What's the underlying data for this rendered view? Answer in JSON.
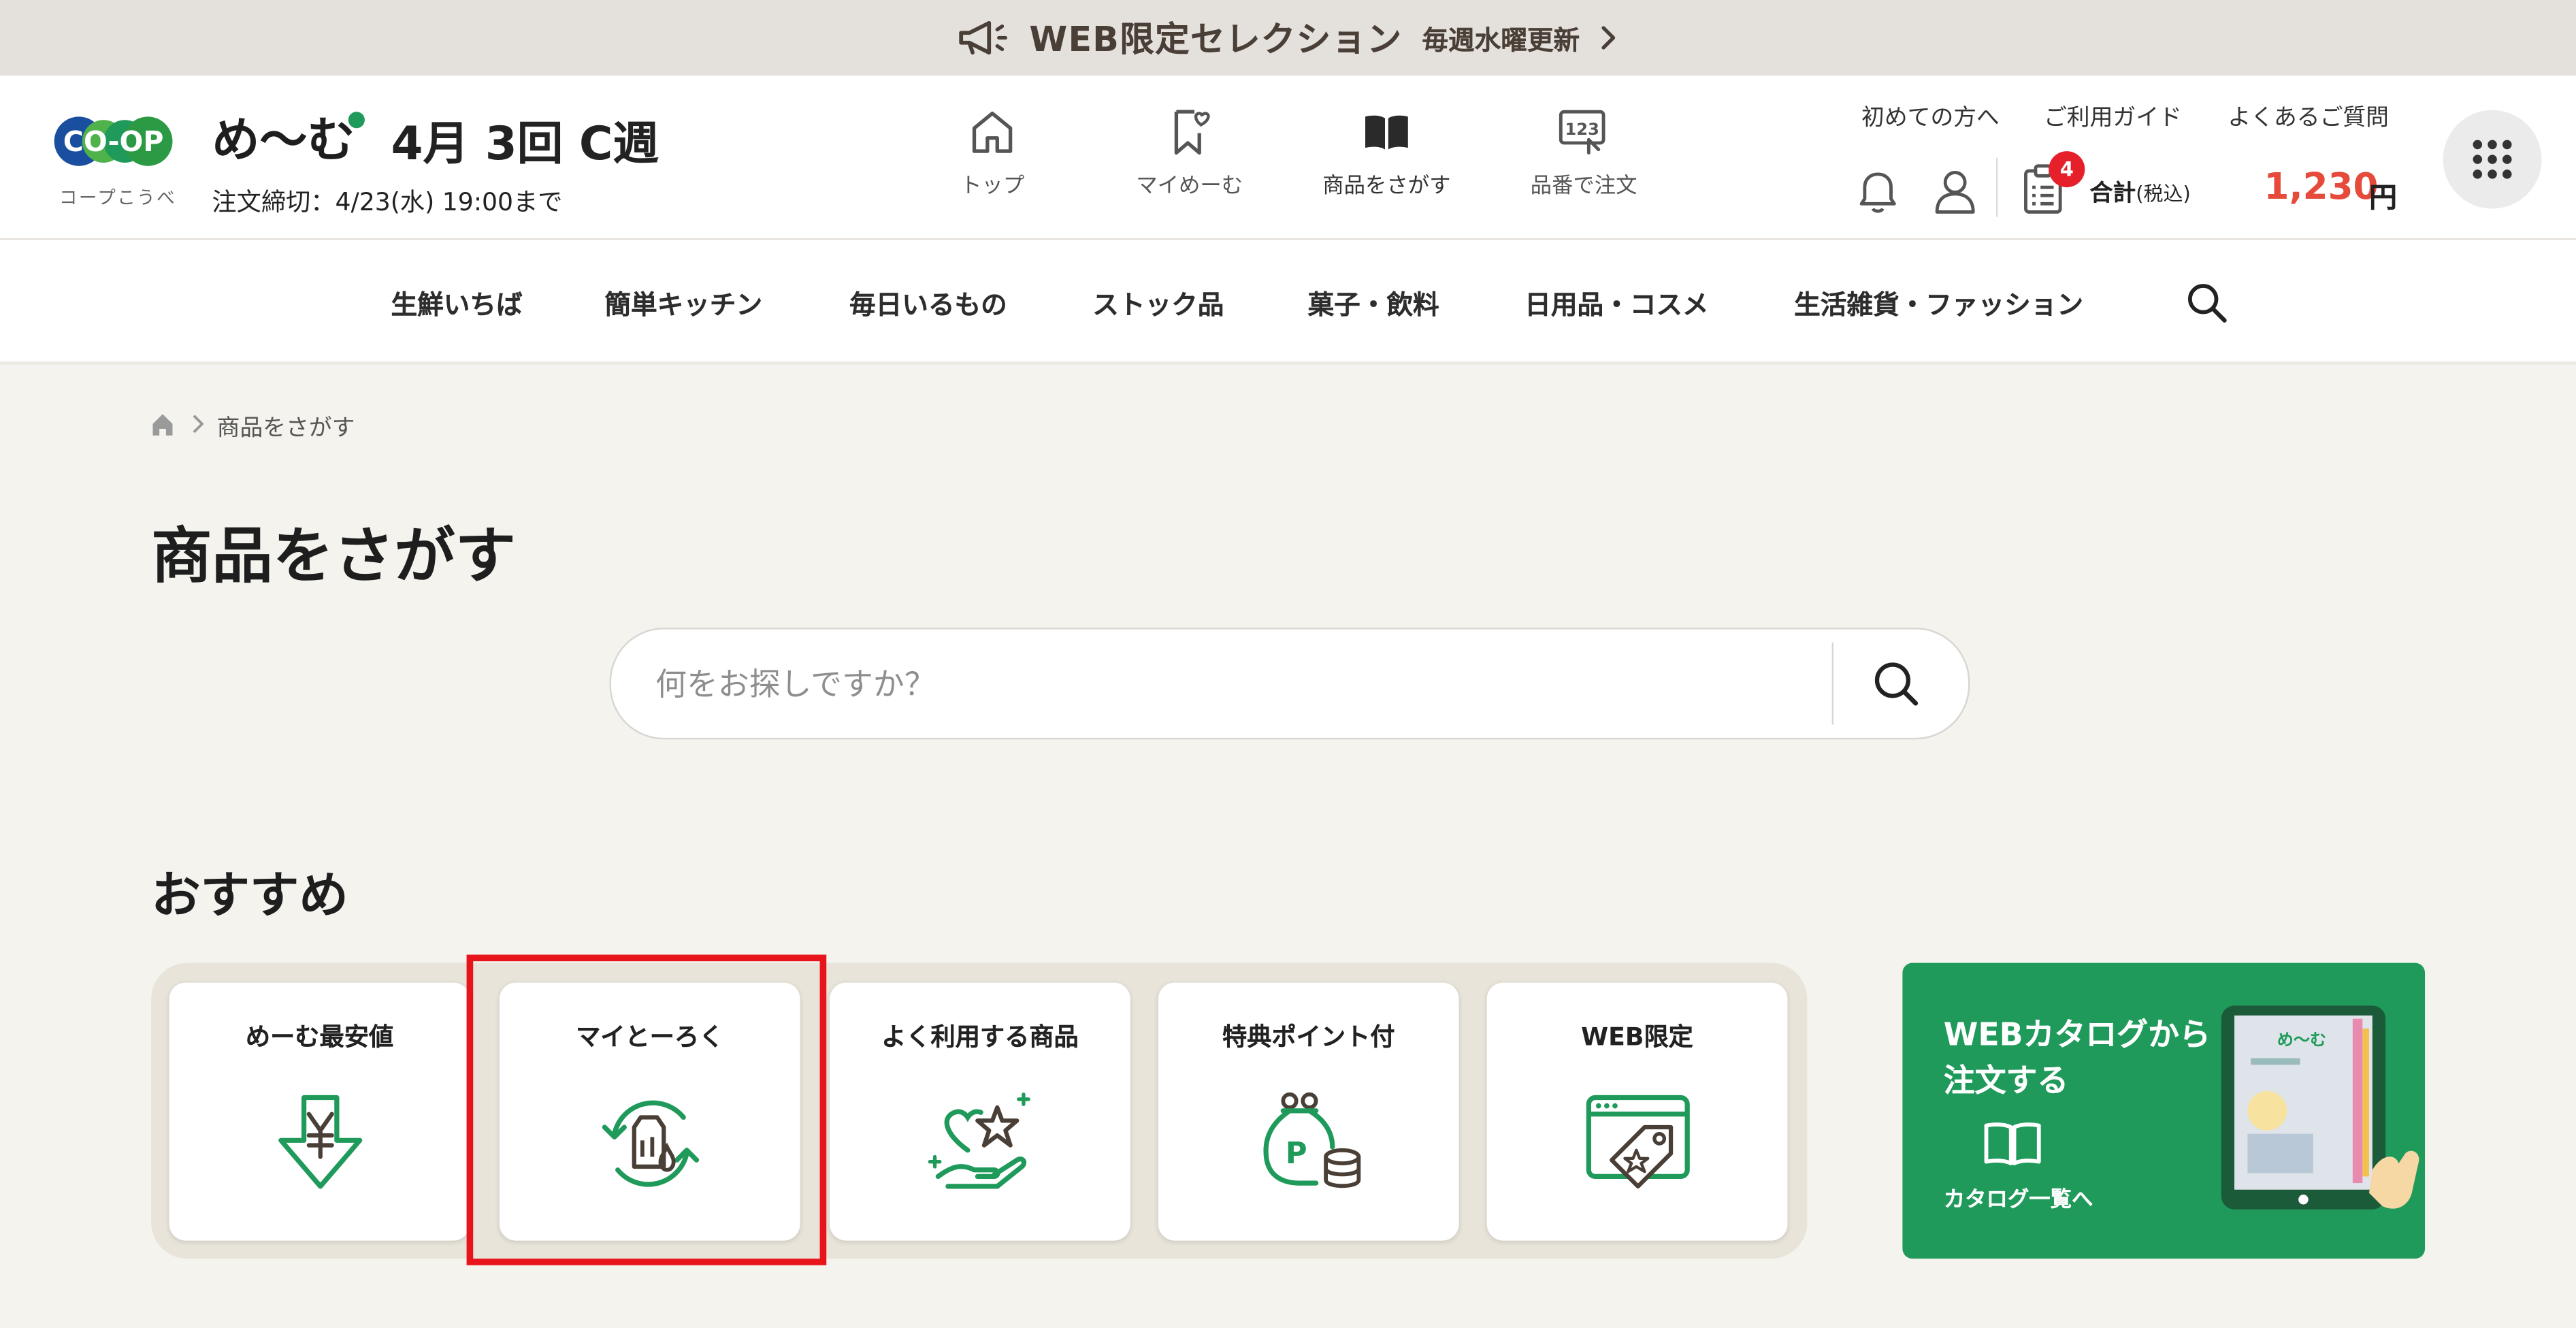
{
  "banner": {
    "title": "WEB限定セレクション",
    "subtitle": "毎週水曜更新"
  },
  "header": {
    "logo_text": "CO-OP",
    "logo_subtext": "コープこうべ",
    "brand": "め〜む",
    "week_month": "4月",
    "week_number": "3回",
    "week_letter": "C週",
    "deadline": "注文締切：4/23(水) 19:00まで",
    "nav": [
      {
        "label": "トップ",
        "icon": "home-icon"
      },
      {
        "label": "マイめーむ",
        "icon": "bookmark-heart-icon"
      },
      {
        "label": "商品をさがす",
        "icon": "open-book-icon"
      },
      {
        "label": "品番で注文",
        "icon": "number-order-icon"
      }
    ],
    "links": [
      "初めての方へ",
      "ご利用ガイド",
      "よくあるご質問"
    ],
    "cart_badge": "4",
    "total_label": "合計",
    "tax_label": "(税込)",
    "total_value": "1,230",
    "currency": "円"
  },
  "categories": [
    "生鮮いちば",
    "簡単キッチン",
    "毎日いるもの",
    "ストック品",
    "菓子・飲料",
    "日用品・コスメ",
    "生活雑貨・ファッション"
  ],
  "breadcrumb": {
    "current": "商品をさがす"
  },
  "page_title": "商品をさがす",
  "search": {
    "placeholder": "何をお探しですか？",
    "value": ""
  },
  "recommend": {
    "title": "おすすめ",
    "cards": [
      {
        "label": "めーむ最安値",
        "icon": "yen-down-arrow-icon"
      },
      {
        "label": "マイとーろく",
        "icon": "register-cycle-icon"
      },
      {
        "label": "よく利用する商品",
        "icon": "hand-heart-star-icon"
      },
      {
        "label": "特典ポイント付",
        "icon": "point-purse-icon"
      },
      {
        "label": "WEB限定",
        "icon": "web-tag-icon"
      }
    ]
  },
  "catalog": {
    "title": "WEBカタログから注文する",
    "link": "カタログ一覧へ",
    "thumbnail_text": "め〜む"
  },
  "colors": {
    "accent_green": "#1f9a5a",
    "price_red": "#e64a3b",
    "highlight_red": "#e8141b",
    "banner_bg": "#e4e1dd"
  }
}
